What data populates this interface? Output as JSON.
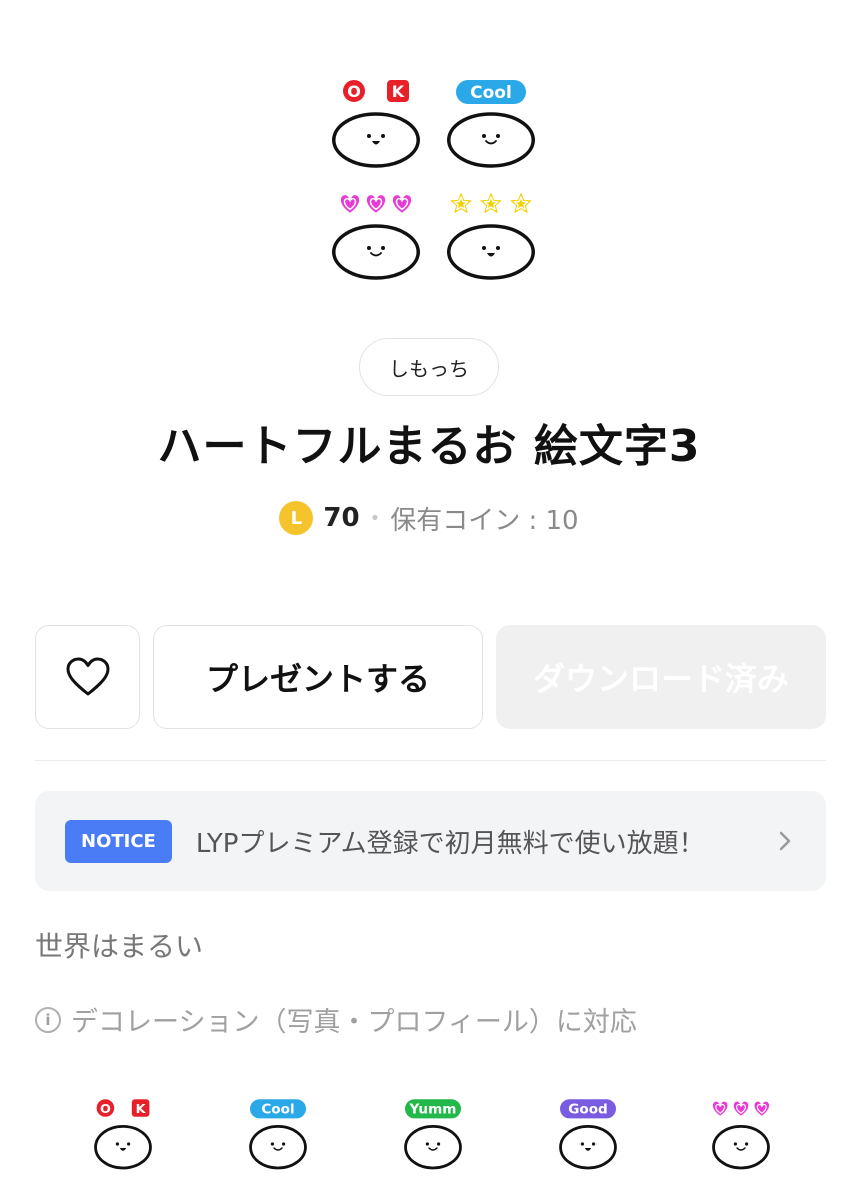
{
  "hero_emoji": [
    {
      "badge": "O K",
      "badge_color": "#e8202a",
      "type": "ok",
      "face": "open-mouth"
    },
    {
      "badge": "Cool",
      "badge_color": "#2aa8e8",
      "type": "text",
      "face": "smile"
    },
    {
      "badge": "hearts",
      "badge_color": "#e83ad4",
      "type": "hearts",
      "face": "smile"
    },
    {
      "badge": "stars",
      "badge_color": "#f4d000",
      "type": "stars",
      "face": "open-mouth"
    }
  ],
  "author": "しもっち",
  "title": "ハートフルまるお 絵文字3",
  "price": {
    "coin_letter": "L",
    "value": "70",
    "separator": "•",
    "owned": "保有コイン : 10"
  },
  "buttons": {
    "present": "プレゼントする",
    "download": "ダウンロード済み"
  },
  "notice": {
    "badge": "NOTICE",
    "text": "LYPプレミアム登録で初月無料で使い放題！"
  },
  "description": "世界はまるい",
  "compat": {
    "icon": "i",
    "text": "デコレーション（写真・プロフィール）に対応"
  },
  "preview_emoji": [
    {
      "badge": "O K",
      "badge_color": "#e8202a",
      "type": "ok"
    },
    {
      "badge": "Cool",
      "badge_color": "#2aa8e8",
      "type": "text"
    },
    {
      "badge": "Yumm",
      "badge_color": "#22b84a",
      "type": "text"
    },
    {
      "badge": "Good",
      "badge_color": "#7a5ce0",
      "type": "text"
    },
    {
      "badge": "hearts",
      "badge_color": "#e83ad4",
      "type": "hearts"
    }
  ],
  "colors": {
    "coin": "#f5c32c",
    "notice_badge": "#4a7cf6",
    "download_bg": "#f0f0f0"
  }
}
